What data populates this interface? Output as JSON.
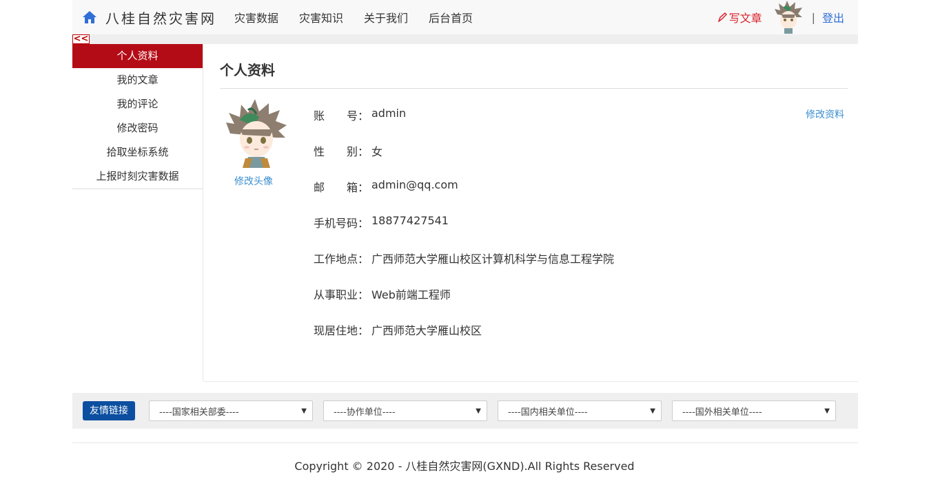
{
  "header": {
    "brand": "八桂自然灾害网",
    "nav": [
      "灾害数据",
      "灾害知识",
      "关于我们",
      "后台首页"
    ],
    "write_label": "写文章",
    "separator": "|",
    "logout_label": "登出"
  },
  "collapse_label": "<<",
  "sidebar": {
    "items": [
      {
        "label": "个人资料",
        "active": true
      },
      {
        "label": "我的文章"
      },
      {
        "label": "我的评论"
      },
      {
        "label": "修改密码"
      },
      {
        "label": "拾取坐标系统"
      },
      {
        "label": "上报时刻灾害数据"
      }
    ]
  },
  "profile": {
    "title": "个人资料",
    "change_avatar": "修改头像",
    "edit_label": "修改资料",
    "fields": [
      {
        "label": "账　　号：",
        "value": "admin"
      },
      {
        "label": "性　　别：",
        "value": "女"
      },
      {
        "label": "邮　　箱：",
        "value": "admin@qq.com"
      },
      {
        "label": "手机号码：",
        "value": "18877427541"
      },
      {
        "label": "工作地点：",
        "value": "广西师范大学雁山校区计算机科学与信息工程学院"
      },
      {
        "label": "从事职业：",
        "value": "Web前端工程师"
      },
      {
        "label": "现居住地：",
        "value": "广西师范大学雁山校区"
      }
    ]
  },
  "links": {
    "button": "友情链接",
    "selects": [
      "----国家相关部委----",
      "----协作单位----",
      "----国内相关单位----",
      "----国外相关单位----"
    ]
  },
  "footer": "Copyright © 2020 - 八桂自然灾害网(GXND).All Rights Reserved",
  "colors": {
    "accent_red": "#b40c17",
    "link_blue": "#3a8ed0",
    "button_blue": "#0c4fa0"
  }
}
